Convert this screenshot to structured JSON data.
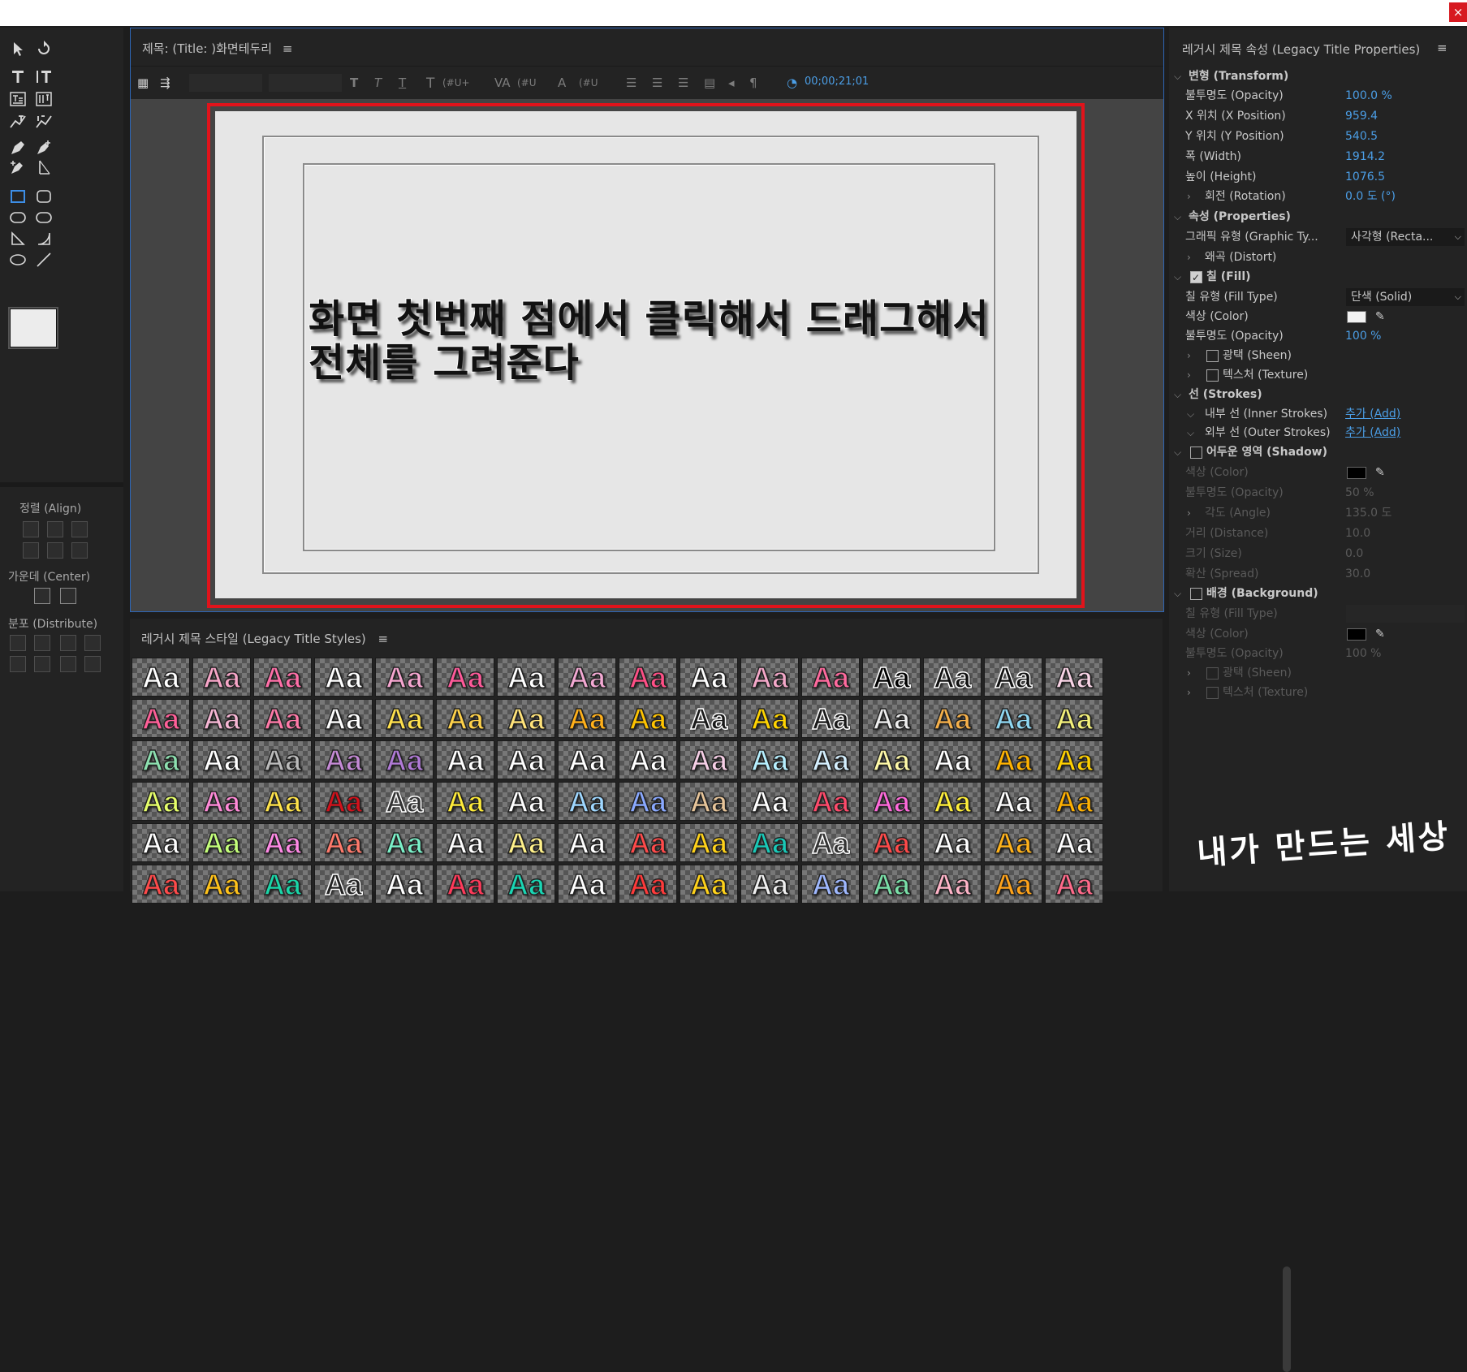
{
  "window": {
    "close_glyph": "×"
  },
  "tools": {
    "items": [
      "selection-tool",
      "rotation-tool",
      "type-tool",
      "vertical-type-tool",
      "area-type-tool",
      "vertical-area-type-tool",
      "path-type-tool",
      "vertical-path-type-tool",
      "pen-tool",
      "add-anchor-tool",
      "delete-anchor-tool",
      "convert-anchor-tool",
      "rectangle-tool",
      "rounded-rectangle-tool",
      "clipped-corner-tool",
      "rounded-corner-tool",
      "wedge-tool",
      "arc-tool",
      "ellipse-tool",
      "line-tool"
    ]
  },
  "align": {
    "align_label": "정렬 (Align)",
    "center_label": "가운데 (Center)",
    "distribute_label": "분포 (Distribute)"
  },
  "editor": {
    "title": "제목: (Title: )화면테두리",
    "menu_glyph": "≡",
    "timecode": "00;00;21;01",
    "toolbar_fields": [
      "(#U+",
      "(#U",
      "(#U"
    ],
    "caption_line1": "화면 첫번째 점에서 클릭해서 드래그해서",
    "caption_line2": "전체를 그려준다"
  },
  "styles": {
    "title": "레거시 제목 스타일 (Legacy Title Styles)",
    "sample": "Aa",
    "colors": [
      "#ffffff",
      "#f7a6c8",
      "#ff6fa8",
      "#ffffff",
      "#f6a6d0",
      "#ff5a9a",
      "#ffffff",
      "#f3a9d3",
      "#ff4f86",
      "#ffffff",
      "#f4a8c9",
      "#ff6a9e",
      "#000000",
      "#111111",
      "#111111",
      "#f9d4e6",
      "#ff5f98",
      "#f6b6d4",
      "#ff7aa8",
      "#ffffff",
      "#ffe14d",
      "#ffd24a",
      "#ffe37a",
      "#ffb01a",
      "#ffc400",
      "#1a1a1a",
      "#ffd400",
      "#1a1a1a",
      "#eeeeee",
      "#f5b04a",
      "#8fd7f2",
      "#f3f07a",
      "#8de0b0",
      "#ffffff",
      "#bbbbbb",
      "#c58ad6",
      "#b07ad6",
      "#ffffff",
      "#ffffff",
      "#ffffff",
      "#ffffff",
      "#f6cfe6",
      "#b7f0ff",
      "#d5f0ff",
      "#fffaa8",
      "#ffffff",
      "#ffb300",
      "#ffd000",
      "#e6ff6a",
      "#ff8ad8",
      "#ffe34a",
      "#d2111b",
      "#333333",
      "#ffec3a",
      "#ffffff",
      "#9fd7ff",
      "#8aa9ff",
      "#e7c59a",
      "#ffffff",
      "#ff4a6b",
      "#ff6adb",
      "#ffef3a",
      "#ffffff",
      "#ffb000",
      "#ffffff",
      "#c4ff7a",
      "#ff8ae6",
      "#ff7a6b",
      "#7af0c8",
      "#ffffff",
      "#fff18a",
      "#ffffff",
      "#ff4a4a",
      "#ffd21a",
      "#19c9b8",
      "#333333",
      "#ff4a4a",
      "#ffffff",
      "#ffb21a",
      "#ffffff",
      "#ff4a4a",
      "#ffc21a",
      "#1ad6a8",
      "#222222",
      "#ffffff",
      "#ff3a5a",
      "#1ad6b4",
      "#ffffff",
      "#ff3a3a",
      "#ffd21a",
      "#f0f0f0",
      "#9fb8ff",
      "#7ae0a8",
      "#ffb4c8",
      "#ffa31a",
      "#ff6a8a"
    ]
  },
  "props": {
    "title": "레거시 제목 속성 (Legacy Title Properties)",
    "menu_glyph": "≡",
    "transform_hdr": "변형 (Transform)",
    "opacity_lbl": "불투명도 (Opacity)",
    "opacity_val": "100.0 %",
    "xpos_lbl": "X 위치 (X Position)",
    "xpos_val": "959.4",
    "ypos_lbl": "Y 위치 (Y Position)",
    "ypos_val": "540.5",
    "width_lbl": "폭 (Width)",
    "width_val": "1914.2",
    "height_lbl": "높이 (Height)",
    "height_val": "1076.5",
    "rotation_lbl": "회전 (Rotation)",
    "rotation_val": "0.0 도 (°)",
    "properties_hdr": "속성 (Properties)",
    "graphic_type_lbl": "그래픽 유형 (Graphic Ty...",
    "graphic_type_val": "사각형 (Recta...",
    "distort_lbl": "왜곡 (Distort)",
    "fill_hdr": "칠 (Fill)",
    "fill_type_lbl": "칠 유형 (Fill Type)",
    "fill_type_val": "단색 (Solid)",
    "color_lbl": "색상 (Color)",
    "fill_color": "#f2f2f2",
    "fill_opacity_lbl": "불투명도 (Opacity)",
    "fill_opacity_val": "100 %",
    "sheen_lbl": "광택 (Sheen)",
    "texture_lbl": "텍스처 (Texture)",
    "strokes_hdr": "선 (Strokes)",
    "inner_lbl": "내부 선 (Inner Strokes)",
    "outer_lbl": "외부 선 (Outer Strokes)",
    "add_lbl": "추가 (Add)",
    "shadow_hdr": "어두운 영역 (Shadow)",
    "shadow_color_lbl": "색상 (Color)",
    "shadow_color": "#000000",
    "shadow_opacity_lbl": "불투명도 (Opacity)",
    "shadow_opacity_val": "50 %",
    "angle_lbl": "각도 (Angle)",
    "angle_val": "135.0 도",
    "distance_lbl": "거리 (Distance)",
    "distance_val": "10.0",
    "size_lbl": "크기 (Size)",
    "size_val": "0.0",
    "spread_lbl": "확산 (Spread)",
    "spread_val": "30.0",
    "background_hdr": "배경 (Background)",
    "bg_fill_type_lbl": "칠 유형 (Fill Type)",
    "bg_color_lbl": "색상 (Color)",
    "bg_color": "#000000",
    "bg_opacity_lbl": "불투명도 (Opacity)",
    "bg_opacity_val": "100 %",
    "bg_sheen_lbl": "광택 (Sheen)",
    "bg_texture_lbl": "텍스처 (Texture)"
  },
  "watermark": "내가 만드는 세상"
}
